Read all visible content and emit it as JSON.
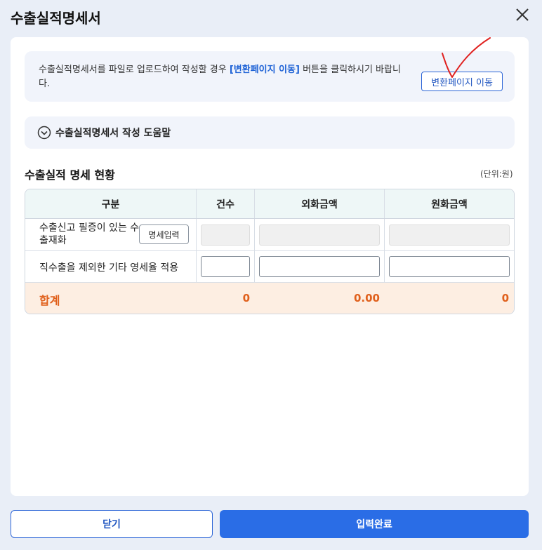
{
  "dialog": {
    "title": "수출실적명세서"
  },
  "notice": {
    "text_before": "수출실적명세서를 파일로 업로드하여 작성할 경우 ",
    "link_text": "[변환페이지 이동]",
    "text_after": " 버튼을 클릭하시기 바랍니다.",
    "convert_button_label": "변환페이지 이동"
  },
  "help": {
    "label": "수출실적명세서 작성 도움말",
    "icon": "chevron-down-circle-icon"
  },
  "section": {
    "title": "수출실적 명세 현황",
    "unit": "(단위:원)"
  },
  "table": {
    "headers": [
      "구분",
      "건수",
      "외화금액",
      "원화금액"
    ],
    "rows": [
      {
        "label": "수출신고 필증이 있는 수출재화",
        "button_label": "명세입력",
        "count": "",
        "foreign_amount": "",
        "krw_amount": "",
        "editable": false
      },
      {
        "label": "직수출을 제외한 기타 영세율 적용",
        "count": "",
        "foreign_amount": "",
        "krw_amount": "",
        "editable": true
      }
    ],
    "total": {
      "label": "합계",
      "count": "0",
      "foreign_amount": "0.00",
      "krw_amount": "0"
    }
  },
  "footer": {
    "close_label": "닫기",
    "submit_label": "입력완료"
  },
  "colors": {
    "accent": "#2a6de6",
    "link": "#1f63d6",
    "total": "#e0601c",
    "annotation": "#e0211f"
  }
}
